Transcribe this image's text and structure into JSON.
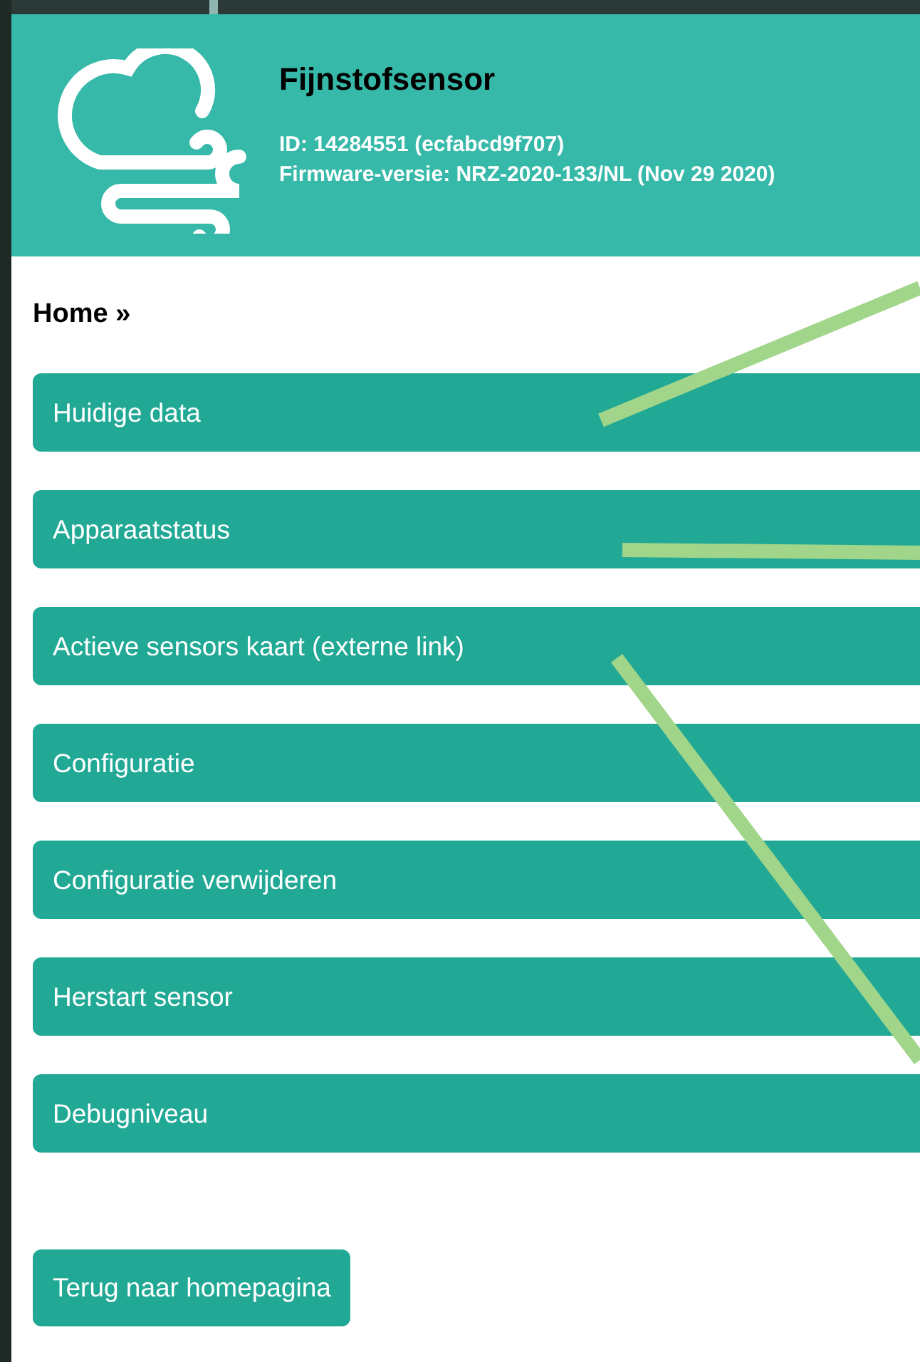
{
  "header": {
    "title": "Fijnstofsensor",
    "id_line": "ID: 14284551 (ecfabcd9f707)",
    "firmware_line": "Firmware-versie: NRZ-2020-133/NL (Nov 29 2020)"
  },
  "breadcrumb": "Home »",
  "menu": [
    {
      "label": "Huidige data"
    },
    {
      "label": "Apparaatstatus"
    },
    {
      "label": "Actieve sensors kaart (externe link)"
    },
    {
      "label": "Configuratie"
    },
    {
      "label": "Configuratie verwijderen"
    },
    {
      "label": "Herstart sensor"
    },
    {
      "label": "Debugniveau"
    }
  ],
  "back_button": "Terug naar homepagina"
}
